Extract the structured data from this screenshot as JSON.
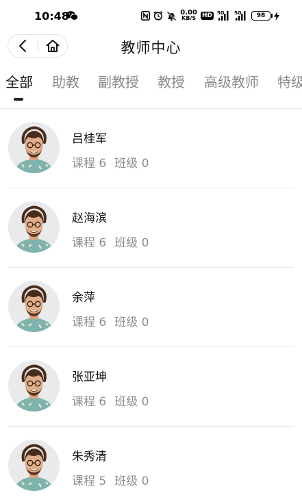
{
  "status_bar": {
    "time": "10:48",
    "net_speed_value": "0.00",
    "net_speed_unit": "KB/S",
    "hd_label": "HD",
    "signal1_label": "5G",
    "signal2_label": "5G",
    "battery_level": "98"
  },
  "header": {
    "title": "教师中心"
  },
  "tabs": [
    {
      "label": "全部",
      "active": true
    },
    {
      "label": "助教",
      "active": false
    },
    {
      "label": "副教授",
      "active": false
    },
    {
      "label": "教授",
      "active": false
    },
    {
      "label": "高级教师",
      "active": false
    },
    {
      "label": "特级",
      "active": false
    }
  ],
  "teachers": [
    {
      "name": "吕桂军",
      "courses": "课程 6",
      "classes": "班级 0"
    },
    {
      "name": "赵海滨",
      "courses": "课程 6",
      "classes": "班级 0"
    },
    {
      "name": "余萍",
      "courses": "课程 6",
      "classes": "班级 0"
    },
    {
      "name": "张亚坤",
      "courses": "课程 6",
      "classes": "班级 0"
    },
    {
      "name": "朱秀清",
      "courses": "课程 5",
      "classes": "班级 0"
    }
  ],
  "colors": {
    "text_primary": "#111111",
    "text_secondary": "#8f8f8f",
    "divider": "#e6e6e6"
  }
}
